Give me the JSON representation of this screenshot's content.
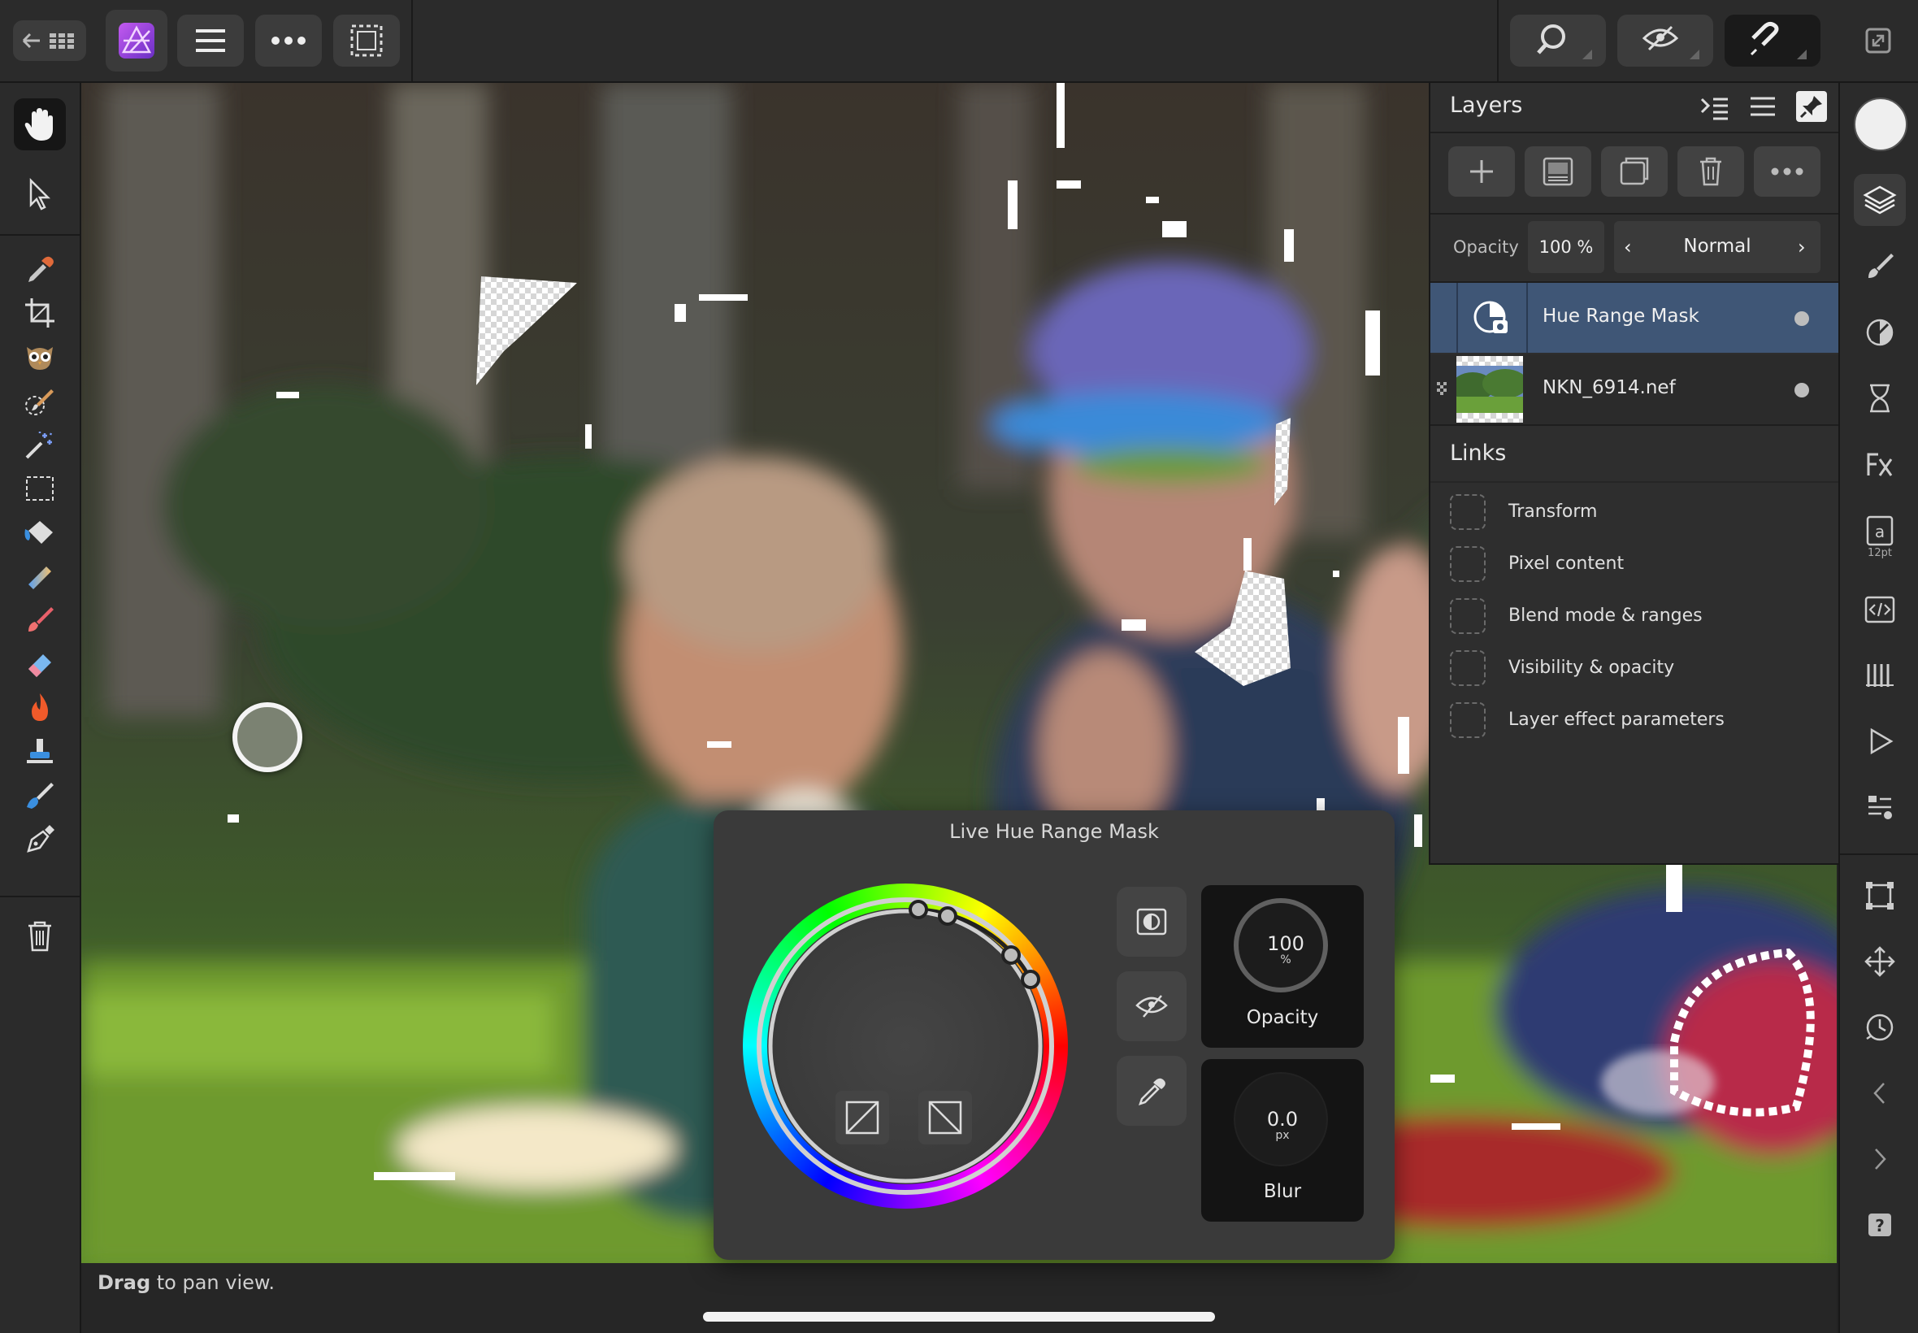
{
  "status": {
    "bold": "Drag",
    "rest": " to pan view."
  },
  "layers_panel": {
    "title": "Layers",
    "opacity_label": "Opacity",
    "opacity_value": "100 %",
    "blend_mode": "Normal",
    "layers": [
      {
        "name": "Hue Range Mask",
        "selected": true
      },
      {
        "name": "NKN_6914.nef",
        "selected": false
      }
    ],
    "links_title": "Links",
    "links": [
      "Transform",
      "Pixel content",
      "Blend mode & ranges",
      "Visibility & opacity",
      "Layer effect parameters"
    ]
  },
  "hue_dialog": {
    "title": "Live Hue Range Mask",
    "opacity": {
      "value": "100",
      "unit": "%",
      "label": "Opacity"
    },
    "blur": {
      "value": "0.0",
      "unit": "px",
      "label": "Blur"
    }
  },
  "studio": {
    "text_size_label": "12pt"
  },
  "colors": {
    "accent_selected_layer": "#3f5676",
    "affinity_purple": "#7b3fc8"
  }
}
